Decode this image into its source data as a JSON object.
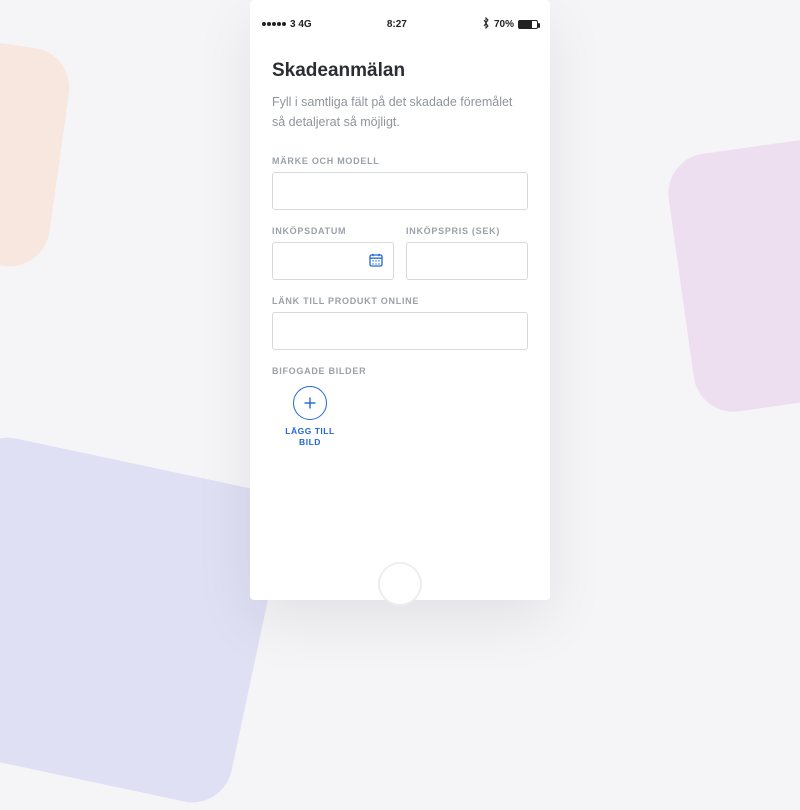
{
  "status": {
    "carrier": "3 4G",
    "time": "8:27",
    "battery_pct": "70%"
  },
  "page": {
    "title": "Skadeanmälan",
    "subtitle": "Fyll i samtliga fält på det skadade föremålet så detaljerat så möjligt."
  },
  "form": {
    "brand_model": {
      "label": "MÄRKE OCH MODELL",
      "value": ""
    },
    "purchase_date": {
      "label": "INKÖPSDATUM",
      "value": ""
    },
    "purchase_price": {
      "label": "INKÖPSPRIS (SEK)",
      "value": ""
    },
    "product_link": {
      "label": "LÄNK TILL PRODUKT ONLINE",
      "value": ""
    },
    "attached_images": {
      "label": "BIFOGADE BILDER"
    },
    "add_image": {
      "label_line1": "LÄGG TILL",
      "label_line2": "BILD"
    }
  },
  "colors": {
    "accent": "#2268d6",
    "border": "#d6dadf",
    "text_muted": "#9aa1a8"
  }
}
